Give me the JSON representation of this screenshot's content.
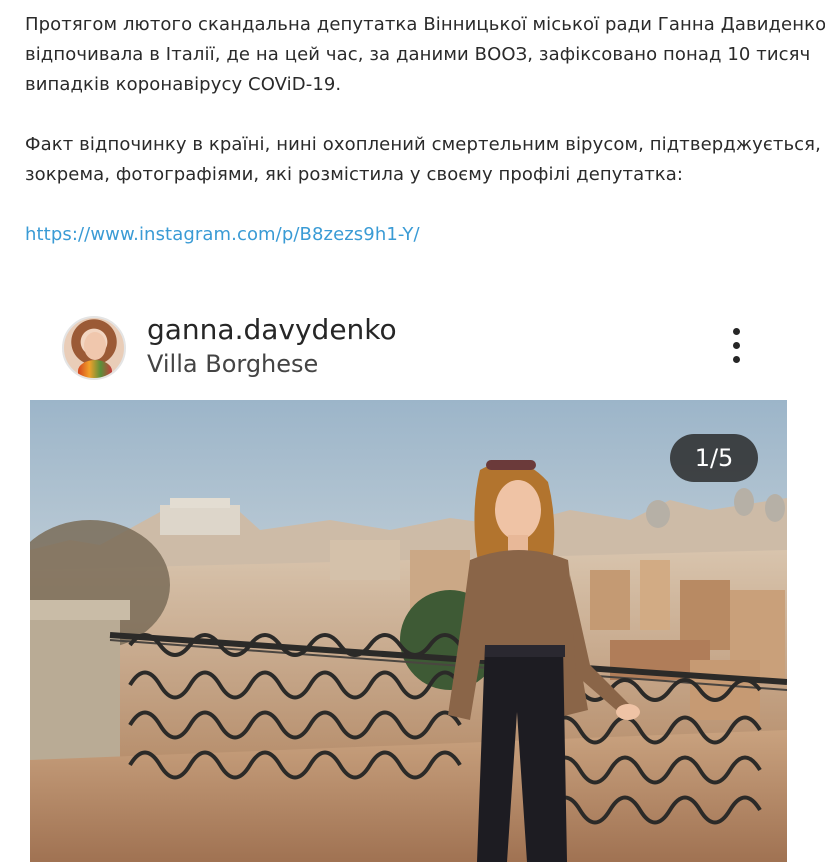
{
  "article": {
    "paragraph1": [
      "Протягом лютого скандальна депутатка Вінницької міської ради Ганна Давиденко",
      "відпочивала в Італії, де на цей час, за даними ВООЗ, зафіксовано понад 10 тисяч",
      "випадків коронавірусу COViD-19."
    ],
    "paragraph2": [
      "Факт відпочинку в країні, нині охоплений смертельним вірусом, підтверджується,",
      "зокрема, фотографіями, які розмістила у своєму профілі депутатка:"
    ],
    "link": "https://www.instagram.com/p/B8zezs9h1-Y/"
  },
  "instagram_post": {
    "username": "ganna.davydenko",
    "location": "Villa Borghese",
    "more_icon": "more-vertical-icon",
    "counter": "1/5",
    "photo_description_icon": "photo"
  },
  "colors": {
    "link": "#3a9bd5",
    "text": "#2a2a2a",
    "counter_bg": "#262626"
  }
}
